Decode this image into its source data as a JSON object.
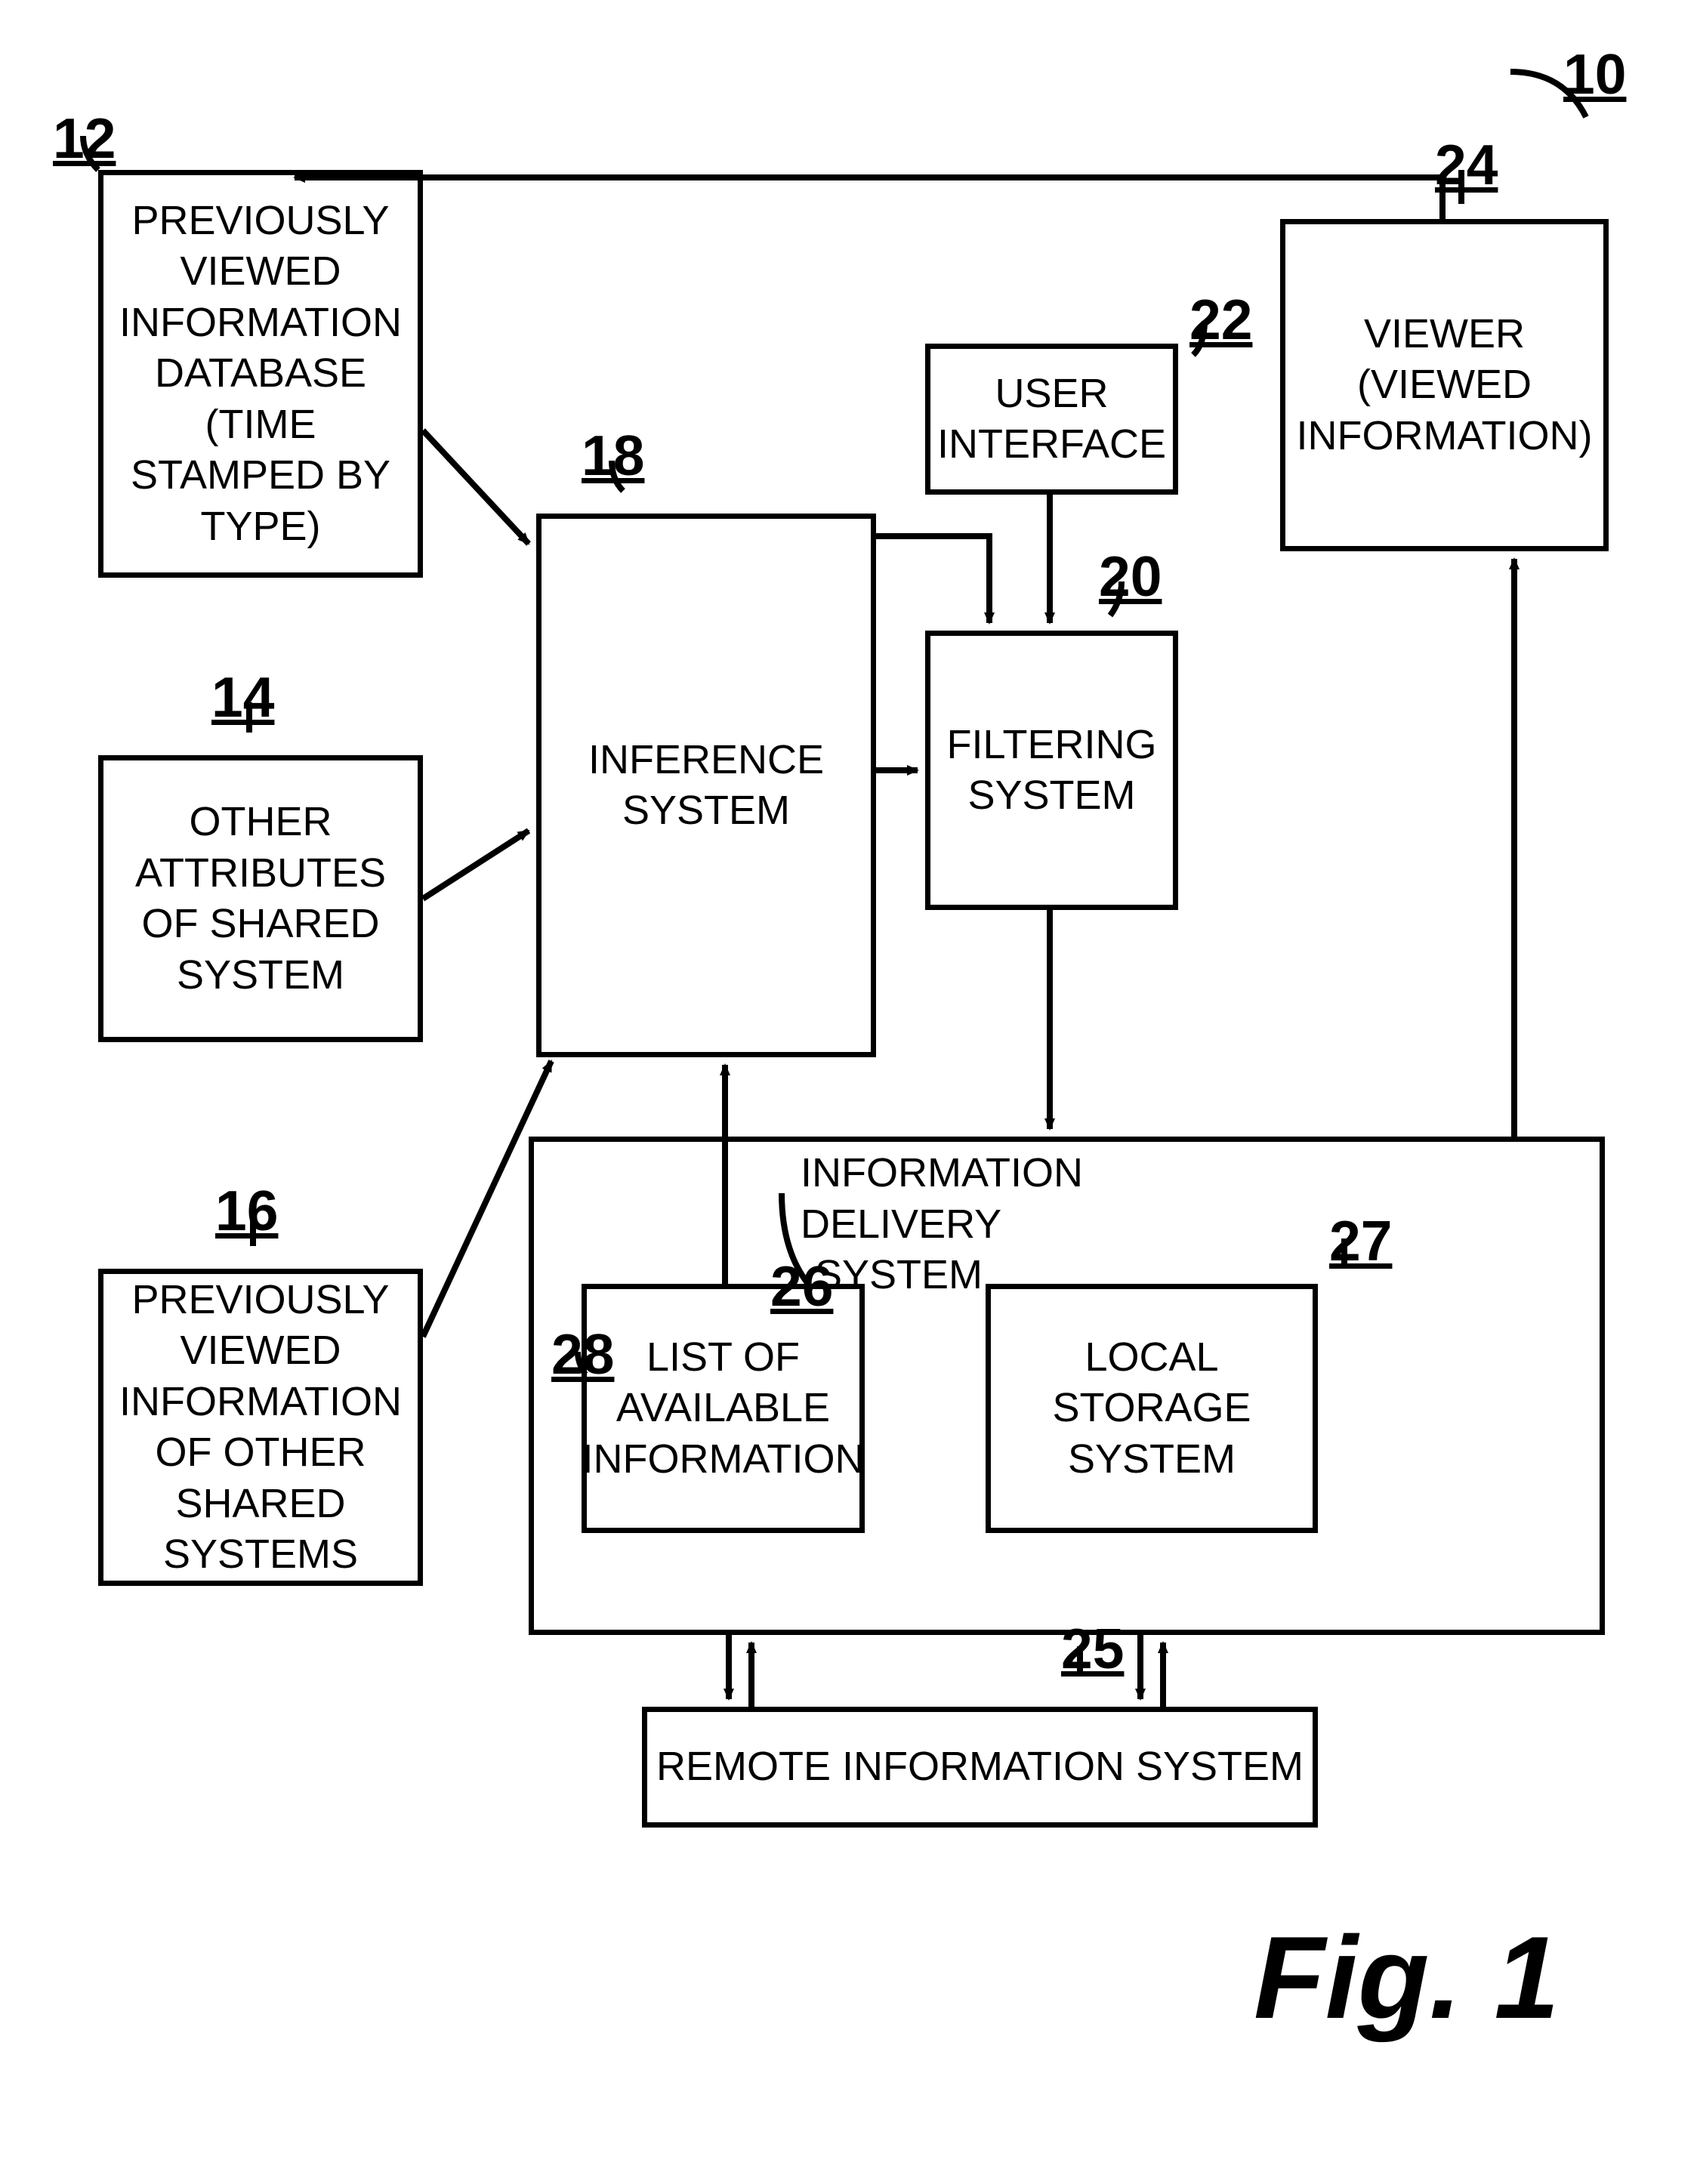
{
  "refs": {
    "r10": "10",
    "r12": "12",
    "r14": "14",
    "r16": "16",
    "r18": "18",
    "r20": "20",
    "r22": "22",
    "r24": "24",
    "r25": "25",
    "r26": "26",
    "r27": "27",
    "r28": "28"
  },
  "boxes": {
    "b12": "PREVIOUSLY VIEWED INFORMATION DATABASE (TIME STAMPED BY TYPE)",
    "b14": "OTHER ATTRIBUTES OF SHARED SYSTEM",
    "b16": "PREVIOUSLY VIEWED INFORMATION OF OTHER SHARED SYSTEMS",
    "b18": "INFERENCE SYSTEM",
    "b20": "FILTERING SYSTEM",
    "b22": "USER INTERFACE",
    "b24": "VIEWER (VIEWED INFORMATION)",
    "b25": "REMOTE  INFORMATION SYSTEM",
    "b27": "LOCAL STORAGE SYSTEM",
    "b28": "LIST OF AVAILABLE INFORMATION"
  },
  "labels": {
    "l26": "INFORMATION DELIVERY SYSTEM"
  },
  "figure": "Fig. 1"
}
